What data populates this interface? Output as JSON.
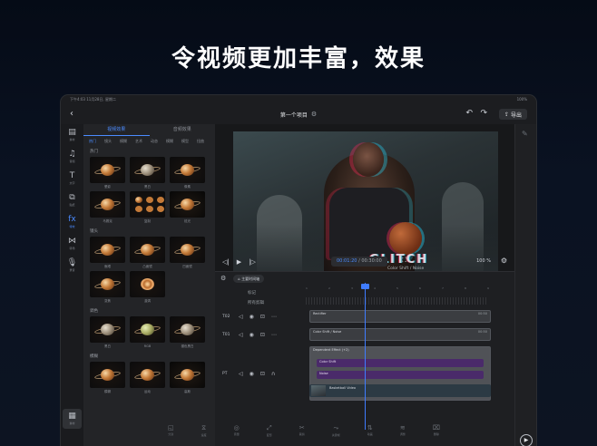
{
  "headline": "令视频更加丰富，效果",
  "status": {
    "time": "下午4:03  11月28日, 星期二",
    "right": "100%"
  },
  "toolbar": {
    "back": "‹",
    "title": "第一个项目",
    "gear": "⚙",
    "undo": "↶",
    "redo": "↷",
    "export": "导出",
    "export_icon": "upload-icon"
  },
  "leftnav": [
    {
      "icon": "▤",
      "label": "素材",
      "name": "nav-media"
    },
    {
      "icon": "♫",
      "label": "音频",
      "name": "nav-audio"
    },
    {
      "icon": "T",
      "label": "文字",
      "name": "nav-text"
    },
    {
      "icon": "⧉",
      "label": "贴纸",
      "name": "nav-sticker"
    },
    {
      "icon": "fx",
      "label": "特效",
      "name": "nav-effects",
      "active": true
    },
    {
      "icon": "⋈",
      "label": "转场",
      "name": "nav-transition"
    },
    {
      "icon": "🎙",
      "label": "录音",
      "name": "nav-record"
    }
  ],
  "leftnav_bottom": {
    "icon": "▦",
    "label": "素材"
  },
  "effects": {
    "tabs": [
      "视频效果",
      "音频效果"
    ],
    "categories": [
      "热门",
      "镜头",
      "模糊",
      "艺术",
      "动态",
      "模糊",
      "模型",
      "扭曲",
      "噪点"
    ],
    "sections": [
      {
        "label": "热门",
        "items": [
          "晕影",
          "黑白",
          "像素",
          "马赛克",
          "复制",
          "炫光"
        ]
      },
      {
        "label": "镜头",
        "items": [
          "鱼眼",
          "凸面镜",
          "凹面镜",
          "变焦",
          "漩涡"
        ]
      },
      {
        "label": "调色",
        "items": [
          "黑白",
          "RGB",
          "褪色黑白"
        ]
      },
      {
        "label": "模糊",
        "items": [
          "模糊",
          "运动",
          "高斯"
        ]
      }
    ]
  },
  "preview": {
    "title": "GLITCH",
    "subtitle": "Color Shift / Noise"
  },
  "transport": {
    "time_current": "00:01:20",
    "time_total": "/ 00:30:00",
    "zoom": "100 %"
  },
  "timeline": {
    "main_track_button": "主要时间轴",
    "ruler": [
      "1",
      "2",
      "3",
      "4",
      "5",
      "6",
      "7",
      "8",
      "9"
    ],
    "marker_label": "标记",
    "all_tracks_label": "所有剪辑",
    "tracks": [
      {
        "name": "T02",
        "clip": "Rectifier",
        "end": "00:50"
      },
      {
        "name": "T01",
        "clip": "Color Shift / Noise",
        "end": "00:50"
      },
      {
        "name": "PT",
        "clip": "Dependent Effect (+2)"
      }
    ],
    "subclips": [
      "Color Shift",
      "Noise"
    ],
    "video_clip": "Basketball Video"
  },
  "bottom_tools": [
    {
      "icon": "◱",
      "label": "分割"
    },
    {
      "icon": "⧖",
      "label": "速度"
    },
    {
      "icon": "◎",
      "label": "音量"
    },
    {
      "icon": "⤢",
      "label": "变形"
    },
    {
      "icon": "✂",
      "label": "裁剪"
    },
    {
      "icon": "⤳",
      "label": "关键帧"
    },
    {
      "icon": "⇅",
      "label": "动画"
    },
    {
      "icon": "≋",
      "label": "调整"
    },
    {
      "icon": "⌧",
      "label": "删除"
    }
  ],
  "right": {
    "pen": "✎",
    "play": "▶",
    "play_label": "播放"
  },
  "colors": {
    "accent": "#4b8bff",
    "clip_purple": "#4a2a6a"
  }
}
